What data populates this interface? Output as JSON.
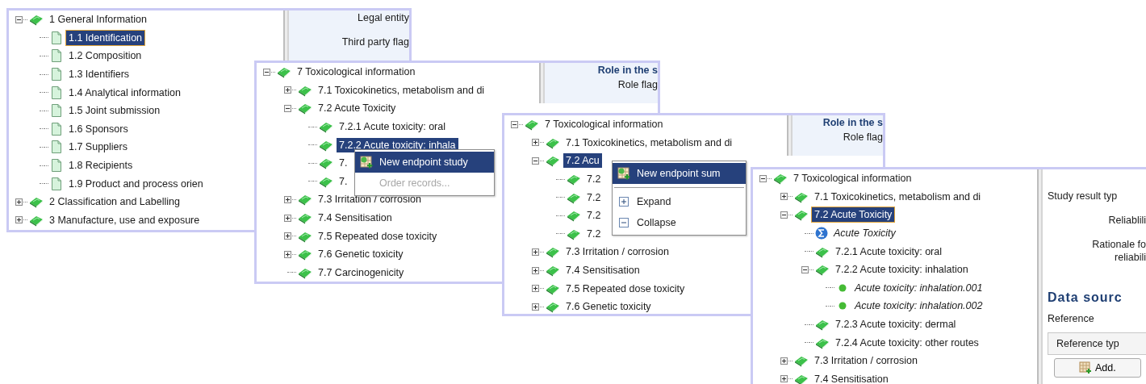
{
  "windows": [
    {
      "tree": [
        {
          "label": "1 General Information",
          "kind": "section",
          "expanded": true,
          "selected": false,
          "children": [
            {
              "label": "1.1 Identification",
              "kind": "page",
              "selected": true
            },
            {
              "label": "1.2 Composition",
              "kind": "page",
              "selected": false
            },
            {
              "label": "1.3 Identifiers",
              "kind": "page",
              "selected": false
            },
            {
              "label": "1.4 Analytical information",
              "kind": "page",
              "selected": false
            },
            {
              "label": "1.5 Joint submission",
              "kind": "page",
              "selected": false
            },
            {
              "label": "1.6 Sponsors",
              "kind": "page",
              "selected": false
            },
            {
              "label": "1.7 Suppliers",
              "kind": "page",
              "selected": false
            },
            {
              "label": "1.8 Recipients",
              "kind": "page",
              "selected": false
            },
            {
              "label": "1.9 Product and process orien",
              "kind": "page",
              "selected": false
            }
          ]
        },
        {
          "label": "2 Classification and Labelling",
          "kind": "section",
          "expanded": false,
          "selected": false
        },
        {
          "label": "3 Manufacture, use and exposure",
          "kind": "section",
          "expanded": false,
          "selected": false
        }
      ],
      "side": [
        {
          "kind": "label",
          "text": "Legal entity"
        },
        {
          "kind": "label",
          "text": "Third party flag"
        }
      ]
    },
    {
      "tree": [
        {
          "label": "7 Toxicological information",
          "kind": "section",
          "expanded": true,
          "selected": false,
          "children": [
            {
              "label": "7.1 Toxicokinetics, metabolism and di",
              "kind": "section",
              "expanded": false,
              "selected": false
            },
            {
              "label": "7.2 Acute Toxicity",
              "kind": "section",
              "expanded": true,
              "selected": false,
              "children": [
                {
                  "label": "7.2.1 Acute toxicity: oral",
                  "kind": "section",
                  "selected": false
                },
                {
                  "label": "7.2.2 Acute toxicity: inhala",
                  "kind": "section",
                  "selected": true
                },
                {
                  "label": "7.",
                  "kind": "section",
                  "selected": false
                },
                {
                  "label": "7.",
                  "kind": "section",
                  "selected": false
                }
              ]
            },
            {
              "label": "7.3 Irritation / corrosion",
              "kind": "section",
              "expanded": false,
              "selected": false
            },
            {
              "label": "7.4 Sensitisation",
              "kind": "section",
              "expanded": false,
              "selected": false
            },
            {
              "label": "7.5 Repeated dose toxicity",
              "kind": "section",
              "expanded": false,
              "selected": false
            },
            {
              "label": "7.6 Genetic toxicity",
              "kind": "section",
              "expanded": false,
              "selected": false
            },
            {
              "label": "7.7 Carcinogenicity",
              "kind": "section",
              "selected": false
            }
          ]
        }
      ],
      "menu": [
        {
          "kind": "new-endpoint",
          "label": "New endpoint study",
          "selected": true,
          "disabled": false
        },
        {
          "kind": "plain",
          "label": "Order records...",
          "selected": false,
          "disabled": true
        }
      ],
      "side": [
        {
          "kind": "heading",
          "text": "Role in the s"
        },
        {
          "kind": "label",
          "text": "Role flag"
        }
      ]
    },
    {
      "tree": [
        {
          "label": "7 Toxicological information",
          "kind": "section",
          "expanded": true,
          "selected": false,
          "children": [
            {
              "label": "7.1 Toxicokinetics, metabolism and di",
              "kind": "section",
              "expanded": false,
              "selected": false
            },
            {
              "label": "7.2 Acu",
              "kind": "section",
              "expanded": true,
              "selected": true,
              "children": [
                {
                  "label": "7.2",
                  "kind": "section",
                  "selected": false
                },
                {
                  "label": "7.2",
                  "kind": "section",
                  "selected": false
                },
                {
                  "label": "7.2",
                  "kind": "section",
                  "selected": false
                },
                {
                  "label": "7.2",
                  "kind": "section",
                  "selected": false
                }
              ]
            },
            {
              "label": "7.3 Irritation / corrosion",
              "kind": "section",
              "expanded": false,
              "selected": false
            },
            {
              "label": "7.4 Sensitisation",
              "kind": "section",
              "expanded": false,
              "selected": false
            },
            {
              "label": "7.5 Repeated dose toxicity",
              "kind": "section",
              "expanded": false,
              "selected": false
            },
            {
              "label": "7.6 Genetic toxicity",
              "kind": "section",
              "expanded": false,
              "selected": false
            }
          ]
        }
      ],
      "menu": [
        {
          "kind": "new-endpoint",
          "label": "New endpoint sum",
          "selected": true,
          "disabled": false
        },
        {
          "kind": "separator"
        },
        {
          "kind": "expand",
          "label": "Expand",
          "selected": false,
          "disabled": false
        },
        {
          "kind": "collapse",
          "label": "Collapse",
          "selected": false,
          "disabled": false
        }
      ],
      "side": [
        {
          "kind": "heading",
          "text": "Role in the s"
        },
        {
          "kind": "label",
          "text": "Role flag"
        }
      ]
    },
    {
      "tree": [
        {
          "label": "7 Toxicological information",
          "kind": "section",
          "expanded": true,
          "selected": false,
          "children": [
            {
              "label": "7.1 Toxicokinetics, metabolism and di",
              "kind": "section",
              "expanded": false,
              "selected": false
            },
            {
              "label": "7.2 Acute Toxicity",
              "kind": "section",
              "expanded": true,
              "selected": true,
              "children": [
                {
                  "label": "Acute Toxicity",
                  "kind": "summary",
                  "selected": false
                },
                {
                  "label": "7.2.1 Acute toxicity: oral",
                  "kind": "section",
                  "selected": false
                },
                {
                  "label": "7.2.2 Acute toxicity: inhalation",
                  "kind": "section",
                  "expanded": true,
                  "selected": false,
                  "children": [
                    {
                      "label": "Acute toxicity: inhalation.001",
                      "kind": "record",
                      "selected": false
                    },
                    {
                      "label": "Acute toxicity: inhalation.002",
                      "kind": "record",
                      "selected": false
                    }
                  ]
                },
                {
                  "label": "7.2.3 Acute toxicity: dermal",
                  "kind": "section",
                  "selected": false
                },
                {
                  "label": "7.2.4 Acute toxicity: other routes",
                  "kind": "section",
                  "selected": false
                }
              ]
            },
            {
              "label": "7.3 Irritation / corrosion",
              "kind": "section",
              "expanded": false,
              "selected": false
            },
            {
              "label": "7.4 Sensitisation",
              "kind": "section",
              "expanded": false,
              "selected": false
            }
          ]
        }
      ],
      "side": [
        {
          "kind": "caption",
          "text": "Study result typ"
        },
        {
          "kind": "label",
          "text": "Reliablili"
        },
        {
          "kind": "label",
          "text": "Rationale fo"
        },
        {
          "kind": "label-tight",
          "text": "reliabili"
        },
        {
          "kind": "heading",
          "text": "Data sourc"
        },
        {
          "kind": "caption",
          "text": "Reference"
        },
        {
          "kind": "column-header",
          "text": "Reference typ"
        },
        {
          "kind": "button",
          "text": "Add."
        }
      ]
    }
  ]
}
